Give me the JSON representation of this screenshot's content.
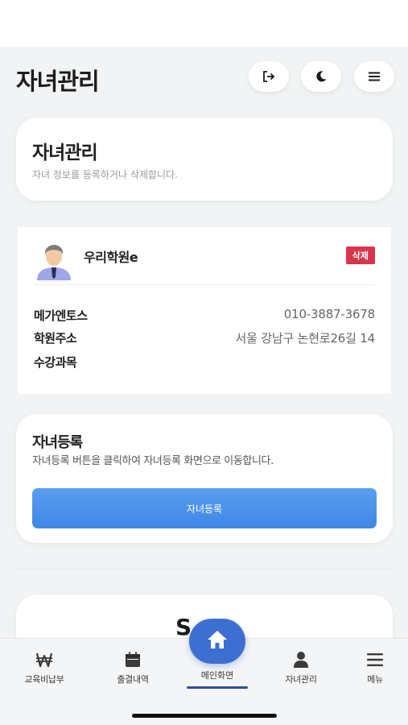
{
  "header": {
    "title": "자녀관리",
    "buttons": [
      {
        "name": "logout",
        "icon": "logout-icon"
      },
      {
        "name": "dark-mode",
        "icon": "moon-icon"
      },
      {
        "name": "menu",
        "icon": "hamburger-icon"
      }
    ]
  },
  "intro": {
    "title": "자녀관리",
    "description": "자녀 정보를 등록하거나 삭제합니다."
  },
  "child": {
    "name": "우리학원e",
    "delete_label": "삭제",
    "rows": [
      {
        "label": "메가엔토스",
        "value": "010-3887-3678"
      },
      {
        "label": "학원주소",
        "value": "서울 강남구 논현로26길 14"
      },
      {
        "label": "수강과목",
        "value": ""
      }
    ]
  },
  "register": {
    "title": "자녀등록",
    "description": "자녀등록 버튼을 클릭하여 자녀등록 화면으로 이동합니다.",
    "button_label": "자녀등록"
  },
  "peek": {
    "text": "S"
  },
  "bottom_nav": {
    "items": [
      {
        "label": "교육비납부",
        "icon": "won-icon"
      },
      {
        "label": "출결내역",
        "icon": "calendar-icon"
      },
      {
        "label": "메인화면",
        "icon": "home-icon"
      },
      {
        "label": "자녀관리",
        "icon": "person-icon"
      },
      {
        "label": "메뉴",
        "icon": "hamburger-icon"
      }
    ]
  },
  "colors": {
    "accent": "#3d6fd1",
    "button": "#4a8fec",
    "danger": "#d9354a",
    "background": "#f1f3f4"
  }
}
